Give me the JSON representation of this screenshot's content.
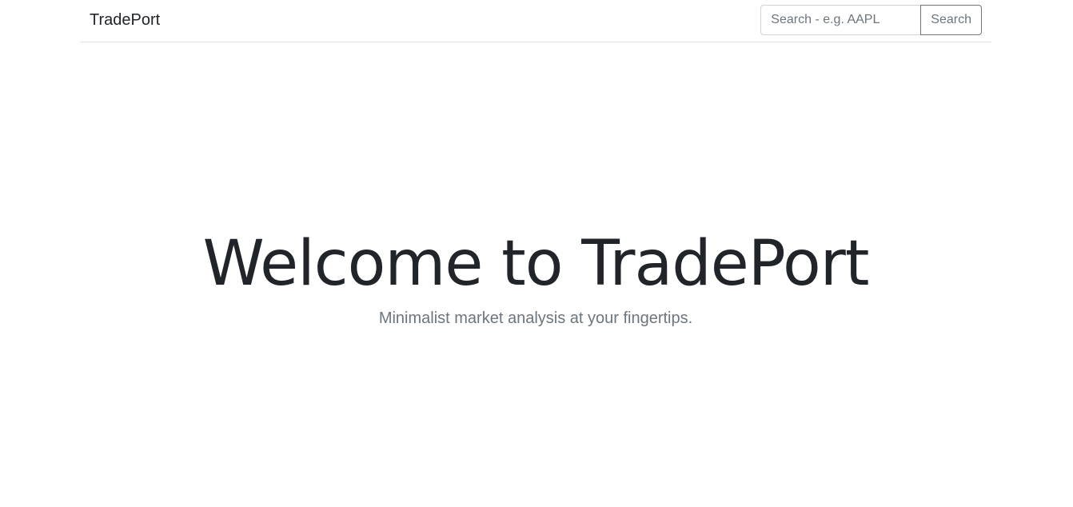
{
  "navbar": {
    "brand": "TradePort",
    "search": {
      "placeholder": "Search - e.g. AAPL",
      "value": "",
      "button_label": "Search"
    }
  },
  "hero": {
    "title": "Welcome to TradePort",
    "subtitle": "Minimalist market analysis at your fingertips."
  }
}
